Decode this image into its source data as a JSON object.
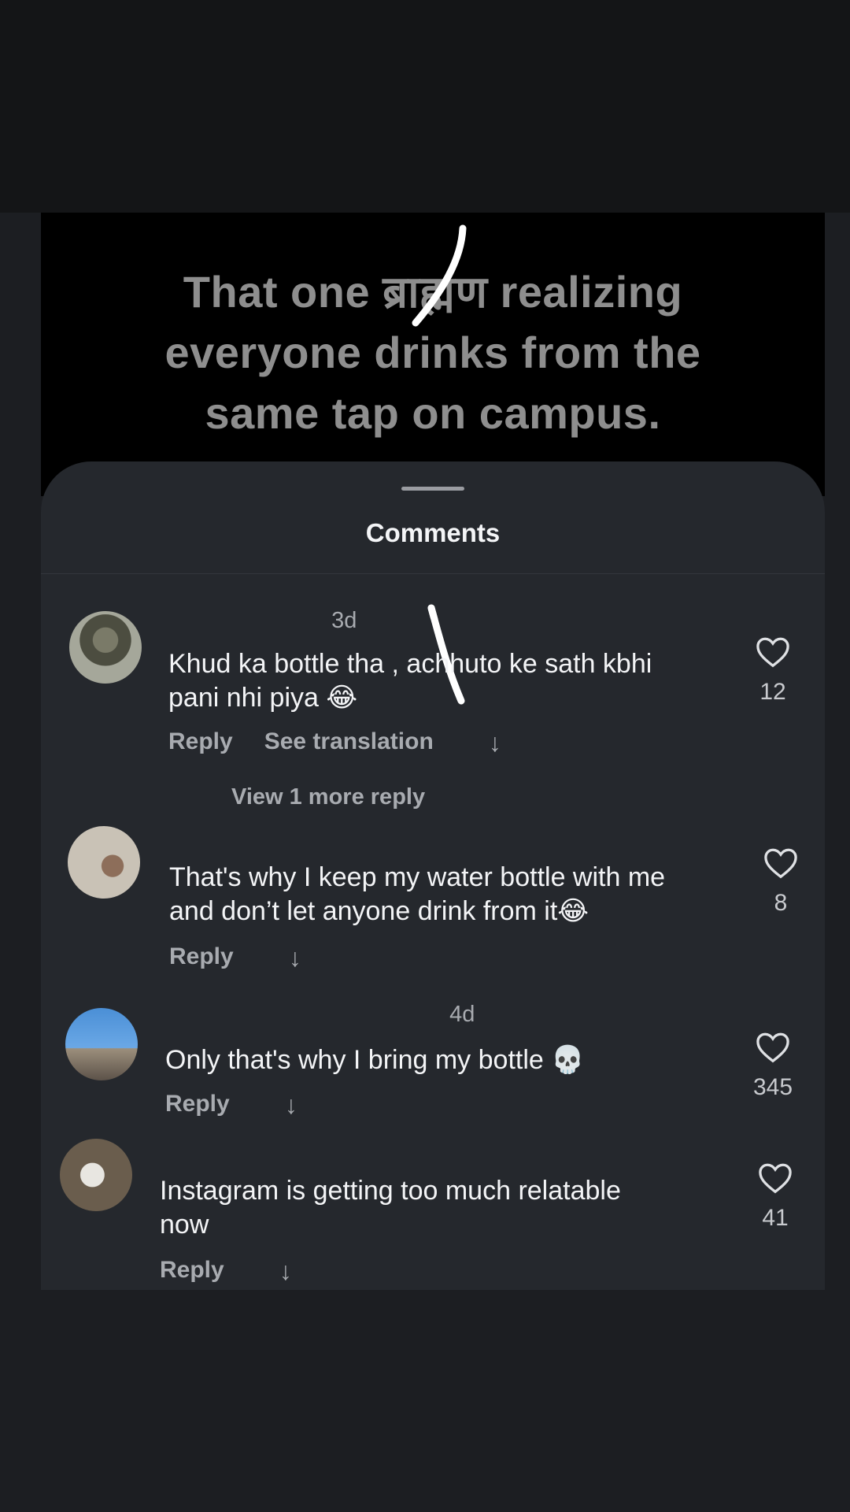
{
  "video": {
    "caption_lines": [
      "That one ब्राह्मण realizing",
      "everyone drinks from the",
      "same tap on campus."
    ]
  },
  "sheet": {
    "title": "Comments"
  },
  "comments": [
    {
      "username": " ",
      "age": "3d",
      "text": [
        "Khud ka bottle tha , achhuto ke sath kbhi",
        "pani nhi piya 😂"
      ],
      "reply_label": "Reply",
      "translation_label": "See translation",
      "likes": "12",
      "more_replies": "View 1 more reply"
    },
    {
      "username": " ",
      "age": "",
      "text": [
        "That's why I keep my water bottle with me",
        "and don’t let anyone drink from it😂"
      ],
      "reply_label": "Reply",
      "likes": "8"
    },
    {
      "username": " ",
      "age": "4d",
      "text": [
        "Only that's why I bring my bottle 💀"
      ],
      "reply_label": "Reply",
      "likes": "345"
    },
    {
      "username": " ",
      "age": "",
      "text": [
        "Instagram is getting too much relatable",
        "now"
      ],
      "reply_label": "Reply",
      "likes": "41"
    }
  ],
  "icons": {
    "heart": "heart-outline-icon",
    "arrow": "arrow-down-icon"
  },
  "colors": {
    "background": "#1c1e22",
    "sheet": "#25282d",
    "secondary_text": "#a8abb0"
  }
}
